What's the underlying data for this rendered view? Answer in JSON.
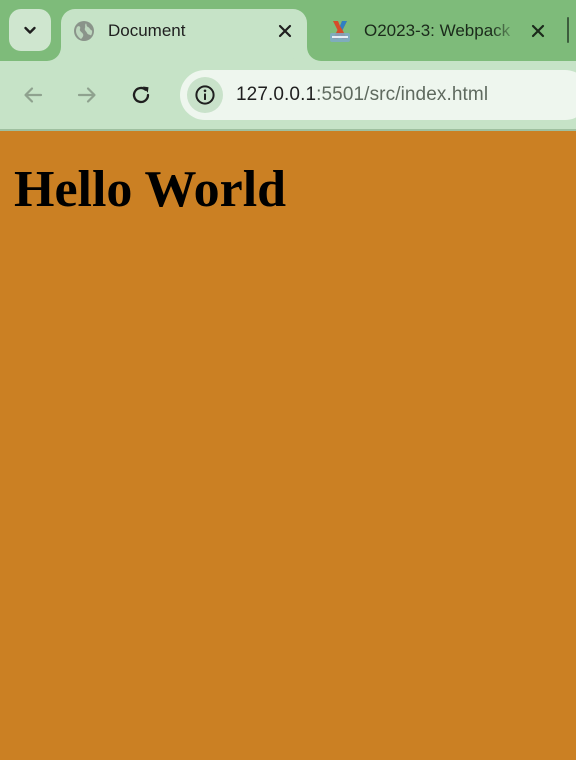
{
  "browser": {
    "tabs": [
      {
        "title": "Document",
        "favicon": "globe-icon",
        "active": true
      },
      {
        "title": "O2023-3: Webpack",
        "favicon": "site-favicon-icon",
        "active": false
      }
    ],
    "tab_search_icon": "chevron-down-icon",
    "toolbar": {
      "back_icon": "arrow-left-icon",
      "forward_icon": "arrow-right-icon",
      "reload_icon": "reload-icon",
      "site_info_icon": "info-icon"
    },
    "address": {
      "host": "127.0.0.1",
      "rest": ":5501/src/index.html"
    },
    "colors": {
      "tabstrip": "#7ebb7a",
      "toolbar": "#c6e3c7",
      "page_background": "#cb8023"
    }
  },
  "page": {
    "heading": "Hello World"
  }
}
